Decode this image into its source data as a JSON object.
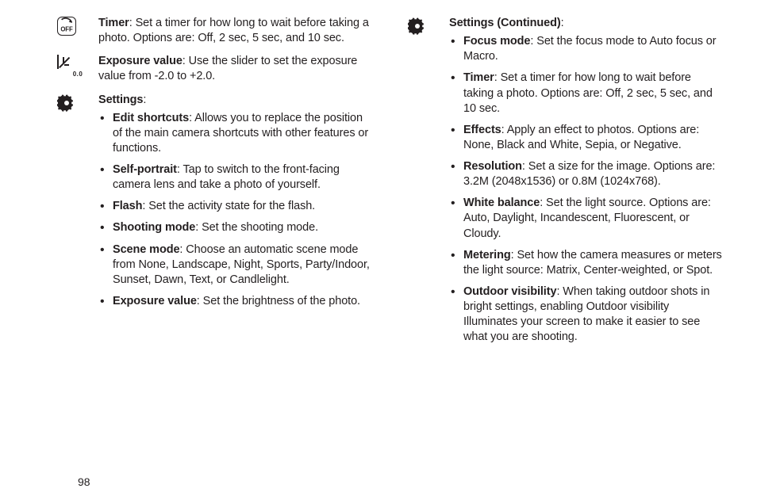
{
  "left": {
    "timer": {
      "label": "Timer",
      "desc": ": Set a timer for how long to wait before taking a photo. Options are: Off, 2 sec, 5 sec, and 10 sec."
    },
    "exposure": {
      "label": "Exposure value",
      "desc": ": Use the slider to set the exposure value from -2.0 to +2.0.",
      "icon_caption": "0.0"
    },
    "settings": {
      "heading": "Settings",
      "items": [
        {
          "label": "Edit shortcuts",
          "desc": ": Allows you to replace the position of the main camera shortcuts with other features or functions."
        },
        {
          "label": "Self-portrait",
          "desc": ": Tap to switch to the front-facing camera lens and take a photo of yourself."
        },
        {
          "label": "Flash",
          "desc": ": Set the activity state for the flash."
        },
        {
          "label": "Shooting mode",
          "desc": ": Set the shooting mode."
        },
        {
          "label": "Scene mode",
          "desc": ": Choose an automatic scene mode from None, Landscape, Night, Sports, Party/Indoor, Sunset, Dawn, Text, or Candlelight."
        },
        {
          "label": "Exposure value",
          "desc": ": Set the brightness of the photo."
        }
      ]
    }
  },
  "right": {
    "heading": "Settings (Continued)",
    "items": [
      {
        "label": "Focus mode",
        "desc": ": Set the focus mode to Auto focus or Macro."
      },
      {
        "label": "Timer",
        "desc": ": Set a timer for how long to wait before taking a photo. Options are: Off, 2 sec, 5 sec, and 10 sec."
      },
      {
        "label": "Effects",
        "desc": ": Apply an effect to photos. Options are: None, Black and White, Sepia, or Negative."
      },
      {
        "label": "Resolution",
        "desc": ": Set a size for the image. Options are: 3.2M (2048x1536) or 0.8M (1024x768)."
      },
      {
        "label": "White balance",
        "desc": ": Set the light source. Options are: Auto, Daylight, Incandescent, Fluorescent, or Cloudy."
      },
      {
        "label": "Metering",
        "desc": ": Set how the camera measures or meters the light source: Matrix, Center-weighted, or Spot."
      },
      {
        "label": "Outdoor visibility",
        "desc": ": When taking outdoor shots in bright settings, enabling Outdoor visibility Illuminates your screen to make it easier to see what you are shooting."
      }
    ]
  },
  "page_number": "98"
}
